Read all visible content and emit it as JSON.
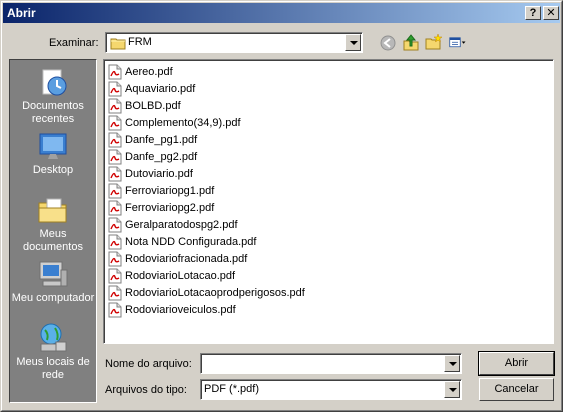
{
  "window": {
    "title": "Abrir"
  },
  "titlebar_buttons": {
    "help": "?",
    "close": "✕"
  },
  "toolbar": {
    "look_in_label": "Examinar:",
    "look_in_value": "FRM",
    "icons": [
      "back-icon",
      "up-folder-icon",
      "new-folder-icon",
      "view-menu-icon"
    ]
  },
  "places": [
    {
      "label": "Documentos recentes",
      "icon": "recent-documents-icon"
    },
    {
      "label": "Desktop",
      "icon": "desktop-icon"
    },
    {
      "label": "Meus documentos",
      "icon": "my-documents-icon"
    },
    {
      "label": "Meu computador",
      "icon": "my-computer-icon"
    },
    {
      "label": "Meus locais de rede",
      "icon": "network-places-icon"
    }
  ],
  "files": [
    "Aereo.pdf",
    "Aquaviario.pdf",
    "BOLBD.pdf",
    "Complemento(34,9).pdf",
    "Danfe_pg1.pdf",
    "Danfe_pg2.pdf",
    "Dutoviario.pdf",
    "Ferroviariopg1.pdf",
    "Ferroviariopg2.pdf",
    "Geralparatodospg2.pdf",
    "Nota NDD Configurada.pdf",
    "Rodoviariofracionada.pdf",
    "RodoviarioLotacao.pdf",
    "RodoviarioLotacaoprodperigosos.pdf",
    "Rodoviarioveiculos.pdf"
  ],
  "filename": {
    "label": "Nome do arquivo:",
    "value": ""
  },
  "filetype": {
    "label": "Arquivos do tipo:",
    "value": "PDF (*.pdf)"
  },
  "buttons": {
    "open": "Abrir",
    "cancel": "Cancelar"
  },
  "colors": {
    "titlebar_start": "#0a246a",
    "titlebar_end": "#a6caf0",
    "face": "#d4d0c8",
    "places_bg": "#808080"
  }
}
